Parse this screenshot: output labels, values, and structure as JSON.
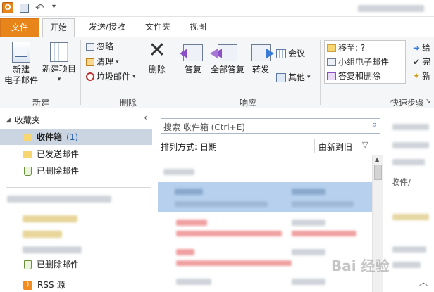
{
  "tabs": {
    "file": "文件",
    "home": "开始",
    "send_receive": "发送/接收",
    "folder": "文件夹",
    "view": "视图"
  },
  "ribbon": {
    "new": {
      "new_email_line1": "新建",
      "new_email_line2": "电子邮件",
      "new_items": "新建项目",
      "group": "新建"
    },
    "delete": {
      "ignore": "忽略",
      "clean_up": "清理",
      "junk": "垃圾邮件",
      "delete": "删除",
      "group": "删除"
    },
    "respond": {
      "reply": "答复",
      "reply_all": "全部答复",
      "forward": "转发",
      "meeting": "会议",
      "more": "其他",
      "group": "响应"
    },
    "quick_steps": {
      "move_to": "移至: ?",
      "team_email": "小组电子邮件",
      "reply_delete": "答复和删除",
      "to_manager": "给",
      "done": "完",
      "create_new": "新",
      "group": "快速步骤"
    }
  },
  "nav": {
    "favorites": "收藏夹",
    "inbox": "收件箱",
    "inbox_count": "(1)",
    "sent": "已发送邮件",
    "deleted": "已删除邮件",
    "deleted2": "已删除邮件",
    "rss": "RSS 源"
  },
  "list": {
    "search_placeholder": "搜索 收件箱 (Ctrl+E)",
    "sort_by": "排列方式: 日期",
    "sort_order": "由新到旧"
  },
  "reading": {
    "inbox_ref": "收件/"
  },
  "watermark": "Bai 经验"
}
